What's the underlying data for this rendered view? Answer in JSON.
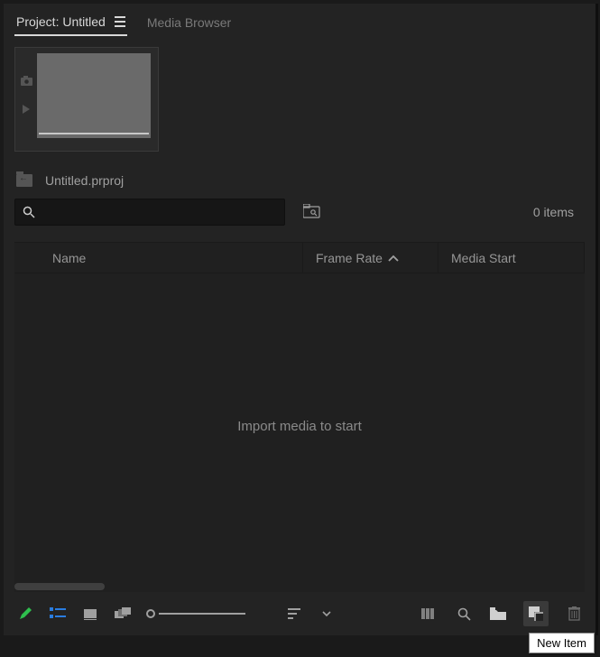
{
  "tabs": {
    "project": "Project: Untitled",
    "media_browser": "Media Browser"
  },
  "project_file": "Untitled.prproj",
  "search": {
    "placeholder": ""
  },
  "item_count": "0 items",
  "columns": {
    "name": "Name",
    "frame_rate": "Frame Rate",
    "media_start": "Media Start"
  },
  "empty_message": "Import media to start",
  "tooltip": "New Item",
  "icons": {
    "pencil": "pencil-icon",
    "list_view": "list-view-icon",
    "icon_view": "icon-view-icon",
    "freeform": "freeform-view-icon",
    "zoom": "zoom-slider",
    "sort": "sort-icon",
    "chevron": "chevron-down-icon",
    "automate": "automate-to-sequence-icon",
    "find": "find-icon",
    "new_bin": "new-bin-icon",
    "new_item": "new-item-icon",
    "trash": "trash-icon"
  }
}
